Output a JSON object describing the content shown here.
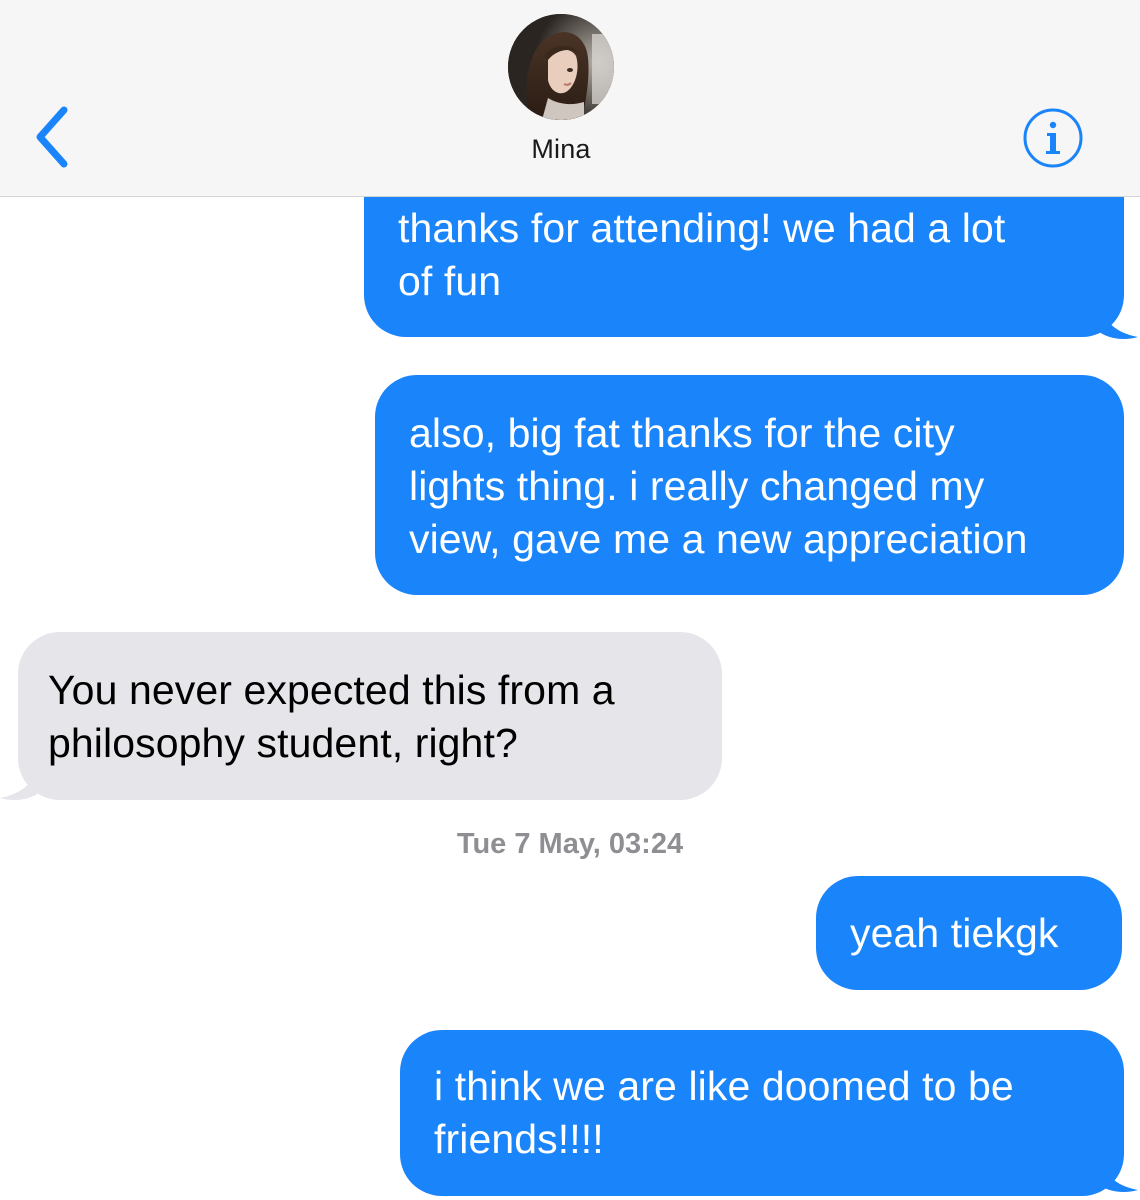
{
  "header": {
    "contact_name": "Mina",
    "back_icon": "chevron-left-icon",
    "info_icon": "info-icon",
    "accent_color": "#1a84fb"
  },
  "messages": [
    {
      "direction": "sent",
      "lines": [
        "thanks for attending! we had a lot",
        "of fun"
      ]
    },
    {
      "direction": "sent",
      "lines": [
        "also, big fat thanks for the city",
        "lights thing. i really changed my",
        "view, gave me a new appreciation"
      ]
    },
    {
      "direction": "received",
      "lines": [
        "You never expected this from a",
        "philosophy student, right?"
      ]
    },
    {
      "direction": "sent",
      "lines": [
        "yeah tiekgk"
      ]
    },
    {
      "direction": "sent",
      "lines": [
        "i think we are like doomed to be",
        "friends!!!!"
      ]
    }
  ],
  "timestamp": "Tue 7 May, 03:24",
  "colors": {
    "sent_bubble": "#1a84fb",
    "received_bubble": "#e5e5ea",
    "header_bg": "#f6f6f6",
    "timestamp_text": "#8e8e93"
  }
}
